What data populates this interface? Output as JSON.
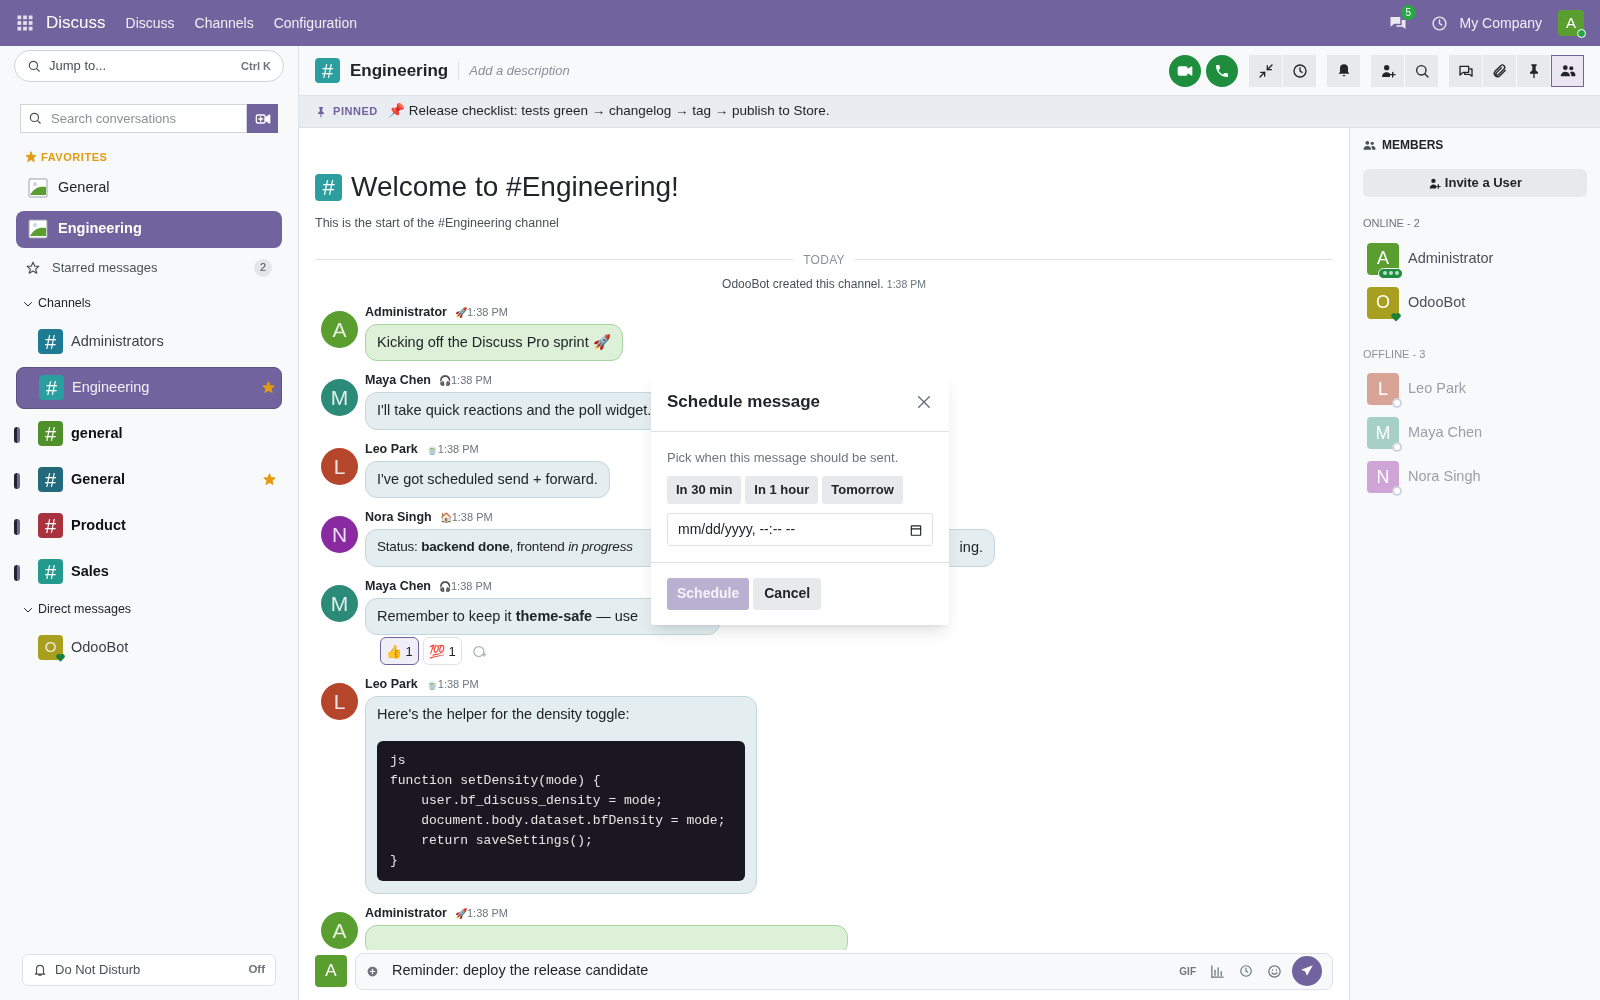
{
  "topbar": {
    "app": "Discuss",
    "menu": [
      "Discuss",
      "Channels",
      "Configuration"
    ],
    "chat_badge": "5",
    "company": "My Company",
    "avatar": "A"
  },
  "sidebar": {
    "jump": {
      "label": "Jump to...",
      "shortcut": "Ctrl K"
    },
    "search": {
      "placeholder": "Search conversations"
    },
    "favorites": {
      "title": "FAVORITES",
      "items": [
        {
          "name": "General",
          "selected": false
        },
        {
          "name": "Engineering",
          "selected": true
        }
      ]
    },
    "starred": {
      "label": "Starred messages",
      "count": "2"
    },
    "channels": {
      "title": "Channels",
      "expanded": true,
      "items": [
        {
          "symbol": "#",
          "name": "Administrators",
          "color": "#1f7a94",
          "selected": false,
          "unread": false,
          "starred": false
        },
        {
          "symbol": "#",
          "name": "Engineering",
          "color": "#2b9ea0",
          "selected": true,
          "unread": false,
          "starred": true
        },
        {
          "symbol": "#",
          "name": "general",
          "color": "#4f8f2c",
          "selected": false,
          "unread": true,
          "starred": false
        },
        {
          "symbol": "#",
          "name": "General",
          "color": "#22697b",
          "selected": false,
          "unread": true,
          "starred": true
        },
        {
          "symbol": "#",
          "name": "Product",
          "color": "#a8323e",
          "selected": false,
          "unread": true,
          "starred": false
        },
        {
          "symbol": "#",
          "name": "Sales",
          "color": "#249a8e",
          "selected": false,
          "unread": true,
          "starred": false
        }
      ]
    },
    "direct": {
      "title": "Direct messages",
      "expanded": true,
      "items": [
        {
          "initial": "O",
          "name": "OdooBot",
          "color": "#a89f1f",
          "selected": false
        }
      ]
    },
    "dnd": {
      "label": "Do Not Disturb",
      "value": "Off"
    }
  },
  "header": {
    "symbol": "#",
    "name": "Engineering",
    "description_placeholder": "Add a description",
    "actions": [
      {
        "kind": "video",
        "selected": false
      },
      {
        "kind": "phone",
        "selected": false
      },
      {
        "kind": "compress",
        "selected": false
      },
      {
        "kind": "clock",
        "selected": false
      },
      {
        "kind": "bell",
        "selected": false
      },
      {
        "kind": "add-user",
        "selected": false
      },
      {
        "kind": "search",
        "selected": false
      },
      {
        "kind": "threads",
        "selected": false
      },
      {
        "kind": "attach",
        "selected": false
      },
      {
        "kind": "pin",
        "selected": false
      },
      {
        "kind": "members",
        "selected": true
      }
    ]
  },
  "pinned": {
    "label": "PINNED",
    "text": "📌 Release checklist: tests green → changelog → tag → publish to Store."
  },
  "welcome": {
    "symbol": "#",
    "title": "Welcome to #Engineering!",
    "subtitle": "This is the start of the #Engineering channel"
  },
  "divider": "TODAY",
  "notice": {
    "text": "OdooBot created this channel.",
    "time": "1:38 PM"
  },
  "messages": [
    {
      "kind": "text",
      "author": "Administrator",
      "initial": "A",
      "color": "#5a9e2f",
      "status": "🚀",
      "time": "1:38 PM",
      "own": true,
      "text": "Kicking off the Discuss Pro sprint 🚀"
    },
    {
      "kind": "text",
      "author": "Maya Chen",
      "initial": "M",
      "color": "#2c8a78",
      "status": "🎧",
      "time": "1:38 PM",
      "own": false,
      "text": "I'll take quick reactions and the poll widget."
    },
    {
      "kind": "text",
      "author": "Leo Park",
      "initial": "L",
      "color": "#b5452b",
      "status": "🍵",
      "time": "1:38 PM",
      "own": false,
      "text": "I've got scheduled send + forward."
    },
    {
      "kind": "split",
      "author": "Nora Singh",
      "initial": "N",
      "color": "#8a2aa0",
      "status": "🏠",
      "time": "1:38 PM",
      "own": false,
      "text": "Status: **backend done**, frontend *in progress*",
      "tail": "ing."
    },
    {
      "kind": "text",
      "author": "Maya Chen",
      "initial": "M",
      "color": "#2c8a78",
      "status": "🎧",
      "time": "1:38 PM",
      "own": false,
      "text": "Remember to keep it **theme-safe** — use",
      "reactions": [
        {
          "emoji": "👍",
          "count": "1",
          "selected": true
        },
        {
          "emoji": "💯",
          "count": "1",
          "selected": false
        }
      ]
    },
    {
      "kind": "code",
      "author": "Leo Park",
      "initial": "L",
      "color": "#b5452b",
      "status": "🍵",
      "time": "1:38 PM",
      "own": false,
      "text": "Here's the helper for the density toggle:",
      "code": "js\nfunction setDensity(mode) {\n    user.bf_discuss_density = mode;\n    document.body.dataset.bfDensity = mode;\n    return saveSettings();\n}"
    },
    {
      "kind": "clipped",
      "author": "Administrator",
      "initial": "A",
      "color": "#5a9e2f",
      "status": "🚀",
      "time": "1:38 PM",
      "own": true
    }
  ],
  "composer": {
    "avatar": "A",
    "value": "Reminder: deploy the release candidate",
    "gif": "GIF"
  },
  "members": {
    "title": "MEMBERS",
    "invite": "Invite a User",
    "groups": [
      {
        "title": "ONLINE - 2",
        "online": true,
        "items": [
          {
            "initial": "A",
            "name": "Administrator",
            "color": "#5a9e2f",
            "kind": "typing"
          },
          {
            "initial": "O",
            "name": "OdooBot",
            "color": "#a89f1f",
            "kind": "bot"
          }
        ]
      },
      {
        "title": "OFFLINE - 3",
        "online": false,
        "items": [
          {
            "initial": "L",
            "name": "Leo Park",
            "color": "#d8a497",
            "kind": "away"
          },
          {
            "initial": "M",
            "name": "Maya Chen",
            "color": "#a5cfc7",
            "kind": "away"
          },
          {
            "initial": "N",
            "name": "Nora Singh",
            "color": "#cfa5d8",
            "kind": "away"
          }
        ]
      }
    ]
  },
  "modal": {
    "title": "Schedule message",
    "hint": "Pick when this message should be sent.",
    "quick": [
      "In 30 min",
      "In 1 hour",
      "Tomorrow"
    ],
    "datetime_placeholder": "mm/dd/yyyy, --:-- --",
    "confirm": {
      "label": "Schedule",
      "disabled": true
    },
    "cancel": "Cancel"
  }
}
